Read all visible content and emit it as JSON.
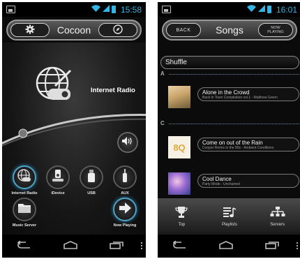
{
  "left_screen": {
    "status": {
      "time": "15:58"
    },
    "header": {
      "title": "Cocoon",
      "settings_icon": "gear-icon",
      "right_icon": "compass-icon"
    },
    "hero": {
      "label": "Internet Radio",
      "icon": "globe-radio-icon"
    },
    "volume_icon": "speaker-icon",
    "sources": [
      {
        "label": "Internet Radio",
        "icon": "globe-radio-icon"
      },
      {
        "label": "iDevice",
        "icon": "ipod-dock-icon"
      },
      {
        "label": "USB",
        "icon": "usb-stick-icon"
      },
      {
        "label": "AUX",
        "icon": "aux-plug-icon"
      },
      {
        "label": "Music Server",
        "icon": "folder-icon"
      },
      {
        "label": "Now Playing",
        "icon": "arrow-right-icon"
      }
    ]
  },
  "right_screen": {
    "status": {
      "time": "16:01"
    },
    "header": {
      "back_label": "BACK",
      "title": "Songs",
      "now_playing_label_1": "NOW",
      "now_playing_label_2": "PLAYING"
    },
    "shuffle_label": "Shuffle",
    "sections": [
      {
        "letter": "A"
      },
      {
        "letter": "C"
      }
    ],
    "songs": [
      {
        "title": "Alone in the Crowd",
        "subtitle": "Back in Town Compilation vol.1 - Matthew Green"
      },
      {
        "title": "Come on out of the Rain",
        "subtitle": "Cooper Remix in the 80s - Ambient Conditions"
      },
      {
        "title": "Cool Dance",
        "subtitle": "Party Mode - Unchained"
      }
    ],
    "album_art_text": "8Q",
    "tabs": [
      {
        "label": "Top",
        "icon": "trophy-icon"
      },
      {
        "label": "Playlists",
        "icon": "playlist-icon"
      },
      {
        "label": "Servers",
        "icon": "network-icon"
      }
    ]
  },
  "colors": {
    "accent": "#33b5e5",
    "active_ring": "#4fa3c7"
  }
}
